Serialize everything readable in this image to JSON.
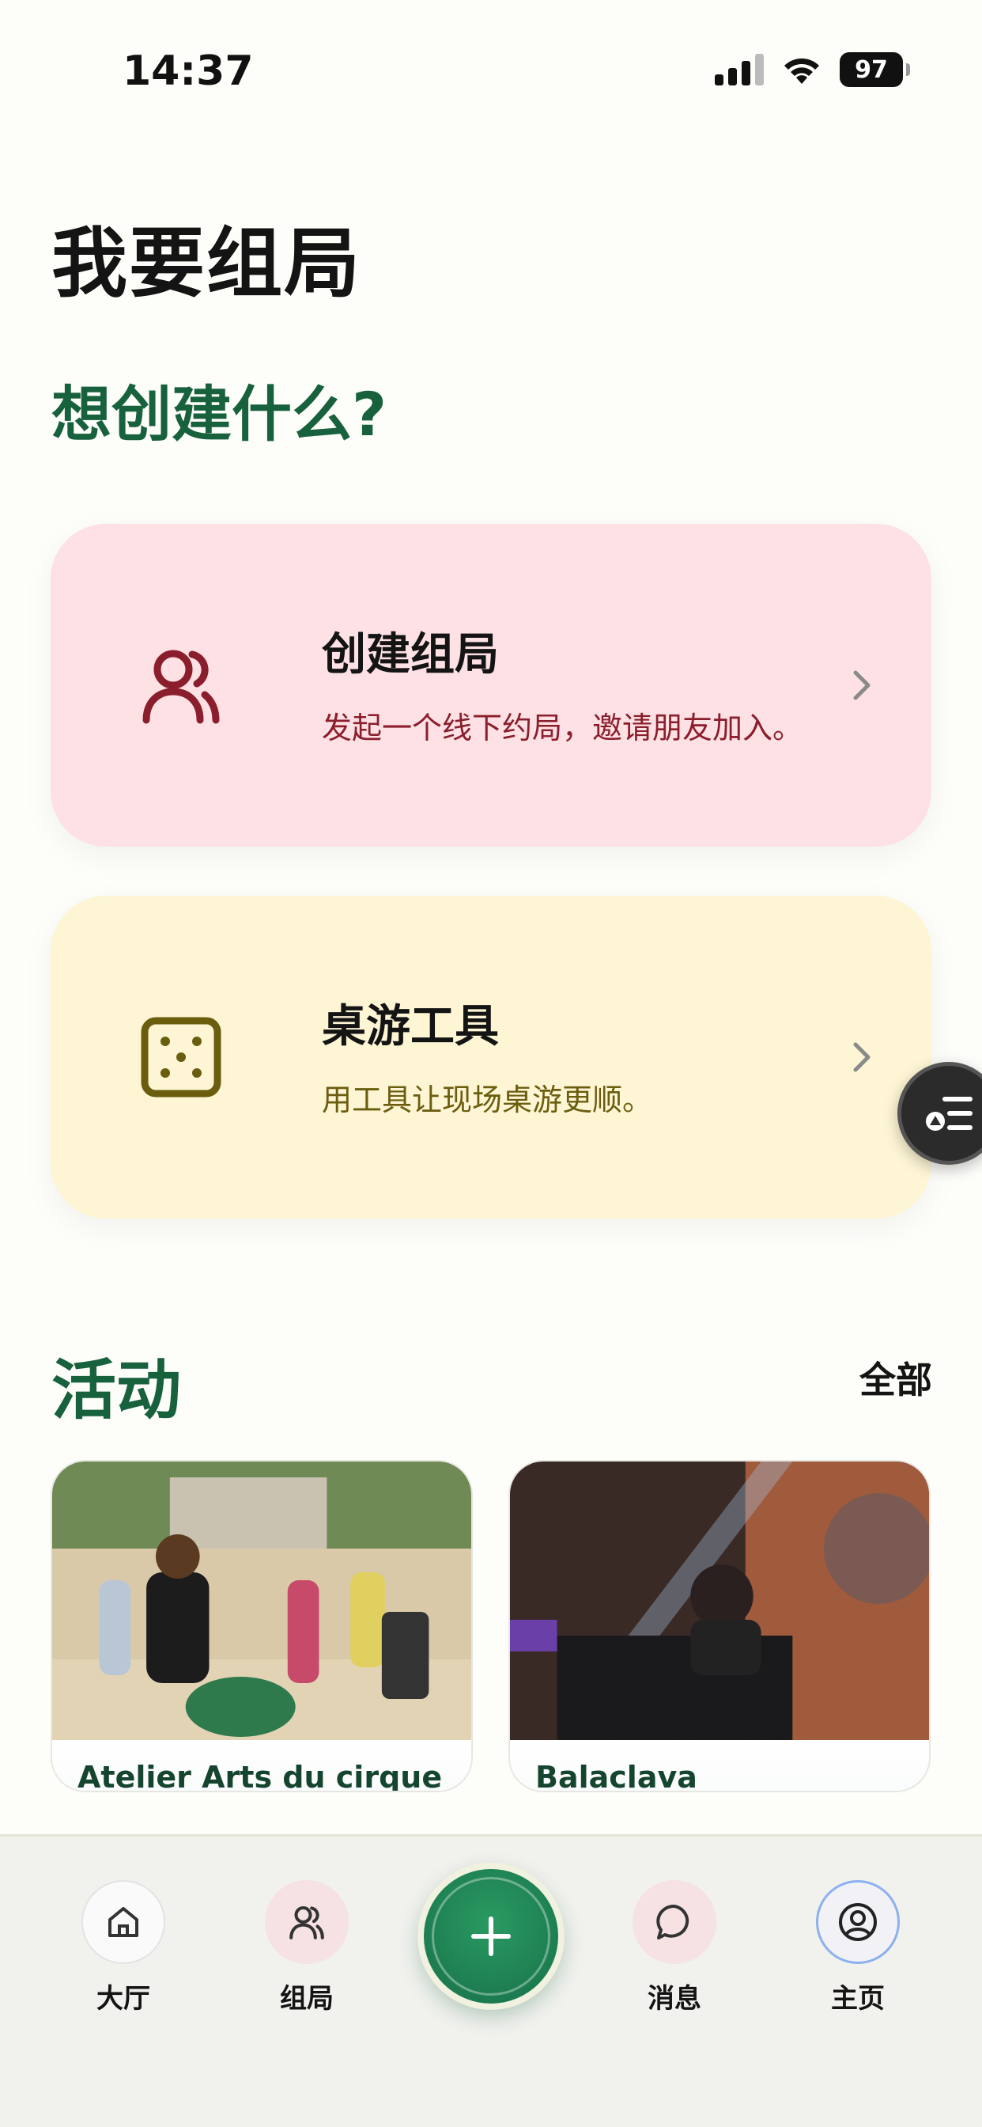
{
  "status_bar": {
    "time": "14:37",
    "battery": "97"
  },
  "header": {
    "title": "我要组局",
    "subtitle": "想创建什么?"
  },
  "cards": {
    "create": {
      "title": "创建组局",
      "description": "发起一个线下约局，邀请朋友加入。",
      "icon": "people-icon"
    },
    "tools": {
      "title": "桌游工具",
      "description": "用工具让现场桌游更顺。",
      "icon": "dice-icon"
    }
  },
  "activity": {
    "title": "活动",
    "all_label": "全部",
    "events": [
      {
        "title": "Atelier Arts du cirque au centre Sportif Jules"
      },
      {
        "title": "Balaclava"
      }
    ]
  },
  "bottom_nav": {
    "items": [
      {
        "label": "大厅",
        "icon": "home-icon"
      },
      {
        "label": "组局",
        "icon": "people-icon"
      },
      {
        "label": "消息",
        "icon": "chat-icon"
      },
      {
        "label": "主页",
        "icon": "profile-icon"
      }
    ],
    "fab_icon": "plus-icon"
  },
  "colors": {
    "accent_green": "#18613d",
    "create_card_bg": "#fde1e4",
    "tools_card_bg": "#fdf5d4"
  }
}
